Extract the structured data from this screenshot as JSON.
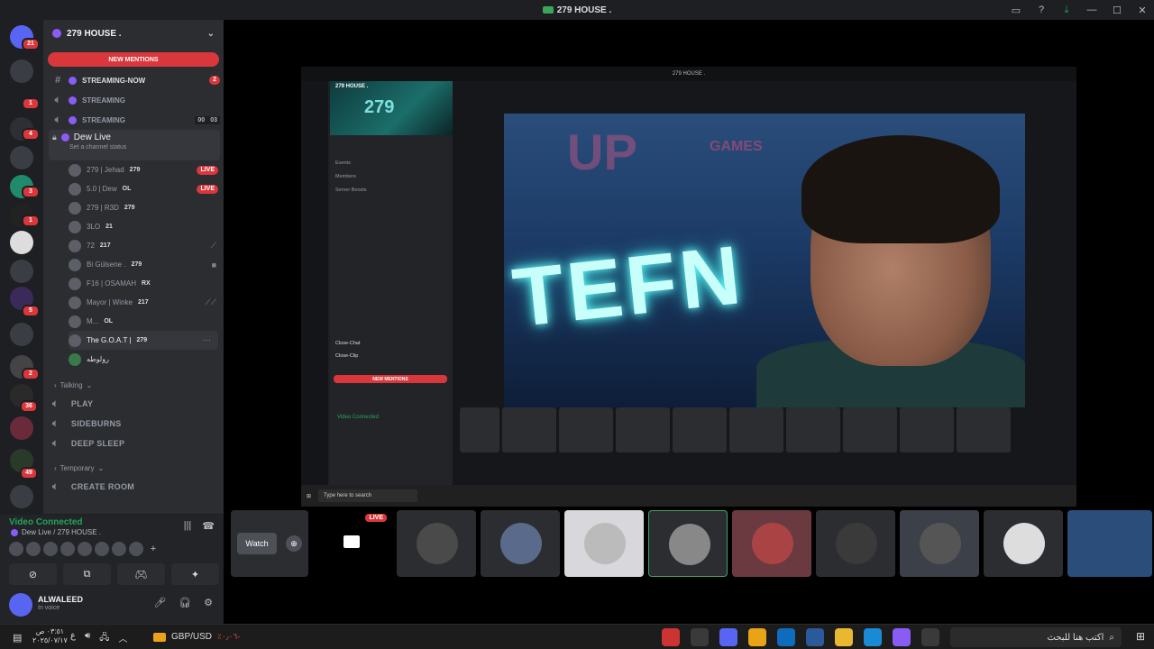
{
  "window": {
    "title": "279 HOUSE ."
  },
  "rail_badges": [
    "21",
    "1",
    "4",
    "3",
    "1",
    "5",
    "2",
    "36",
    "49"
  ],
  "server": {
    "name": "279 HOUSE ."
  },
  "sidebar": {
    "new_mentions": "NEW MENTIONS",
    "channels": [
      {
        "name": "STREAMING-NOW",
        "count": "2"
      },
      {
        "name": "STREAMING"
      },
      {
        "name": "STREAMING",
        "pill": [
          "00",
          "03"
        ]
      }
    ],
    "active_channel": {
      "name": "Dew Live",
      "status": "Set a channel status"
    },
    "members": [
      {
        "name": "279 | Jehad",
        "tag": "279",
        "live": "LIVE"
      },
      {
        "name": "5.0 | Dew",
        "tag": "OL",
        "live": "LIVE"
      },
      {
        "name": "279 | R3D",
        "tag": "279"
      },
      {
        "name": "3LO",
        "tag": "21"
      },
      {
        "name": "72",
        "tag": "217"
      },
      {
        "name": "Bi Gülsene .",
        "tag": "279"
      },
      {
        "name": "F16 | OSAMAH",
        "tag": "RX"
      },
      {
        "name": "Mayor | Winke",
        "tag": "217"
      },
      {
        "name": "M...",
        "tag": "OL"
      },
      {
        "name": "The G.O.A.T |",
        "tag": "279"
      },
      {
        "name": "رولوطه"
      }
    ],
    "categories": {
      "talking": "Talking",
      "temporary": "Temporary"
    },
    "voice_channels": [
      "PLAY",
      "SIDEBURNS",
      "DEEP SLEEP",
      "CREATE ROOM"
    ]
  },
  "voice": {
    "status": "Video Connected",
    "location": "Dew Live / 279 HOUSE ."
  },
  "user": {
    "name": "ALWALEED",
    "status": "In voice"
  },
  "stream": {
    "window_title": "279 HOUSE .",
    "server_name": "279 HOUSE .",
    "banner": "279",
    "items": [
      "Events",
      "Members",
      "Server Boosts",
      "Close-Chat",
      "Close-Clip"
    ],
    "new_mentions": "NEW MENTIONS",
    "video_connected": "Video Connected",
    "neon": {
      "up": "UP",
      "tefn": "TEFN",
      "games": "GAMES"
    },
    "taskbar_search": "Type here to search"
  },
  "participants": {
    "watch": "Watch",
    "live": "LIVE"
  },
  "taskbar": {
    "search_placeholder": "اكتب هنا للبحث",
    "ticker": "GBP/USD",
    "ticker_change": "٪٠٫٠٦-",
    "time": "٠٣:٥١ ص",
    "date": "٢٠٢٥/٠٧/١٧"
  }
}
